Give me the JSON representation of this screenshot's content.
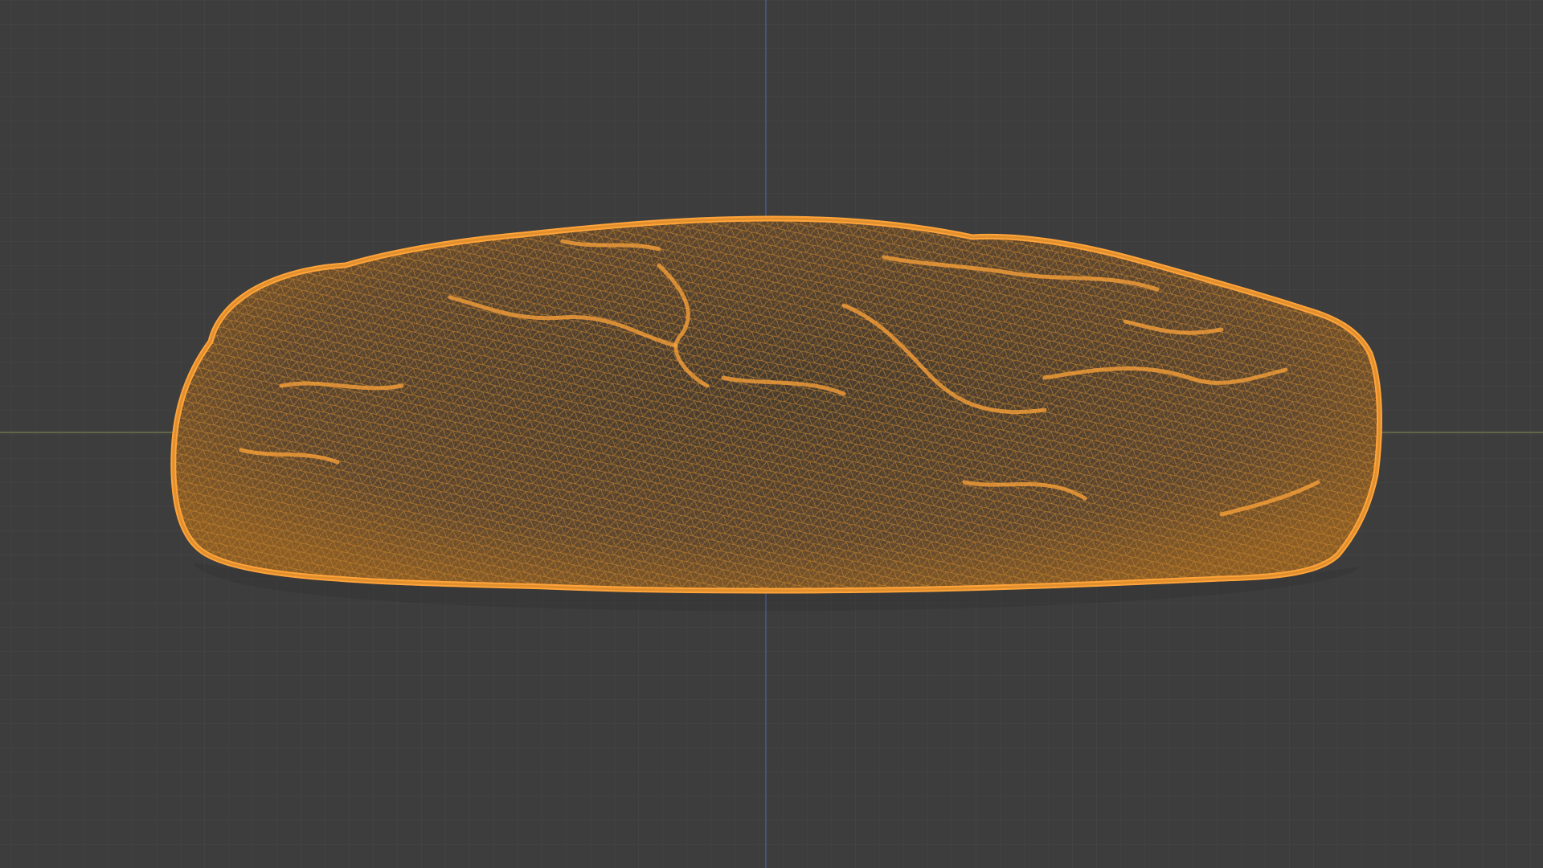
{
  "viewport": {
    "view_mode": "wireframe",
    "selection_state": "selected",
    "axes_visible": [
      "x",
      "z"
    ],
    "grid_visible": true
  },
  "colors": {
    "background": "#3d3d3d",
    "grid_minor": "#454545",
    "grid_major": "#4a4a4a",
    "axis_x": "#6f7548",
    "axis_z": "#4a5f8f",
    "wire_selected": "#ffa43a",
    "wire_dim": "#c77e28",
    "mesh_fill": "#4a3f32"
  },
  "scene": {
    "selected_object": {
      "shape": "bread-loaf-icon",
      "wireframe_color": "#ffa43a"
    }
  }
}
